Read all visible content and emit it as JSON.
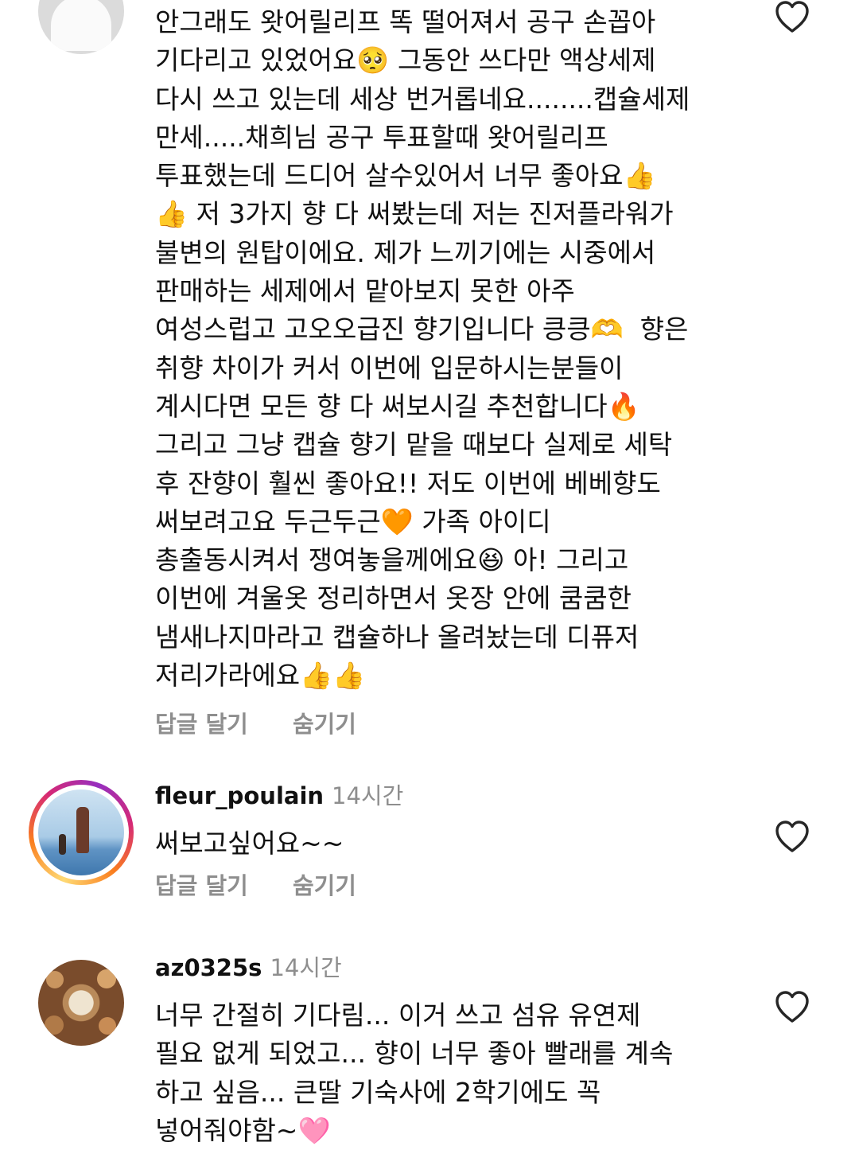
{
  "comments": [
    {
      "username": "",
      "time": "",
      "text": "안그래도 왓어릴리프 똑 떨어져서 공구 손꼽아\n기다리고 있었어요🥺 그동안 쓰다만 액상세제\n다시 쓰고 있는데 세상 번거롭네요........캡슐세제\n만세.....채희님 공구 투표할때 왓어릴리프\n투표했는데 드디어 살수있어서 너무 좋아요👍\n👍 저 3가지 향 다 써봤는데 저는 진저플라워가\n불변의 원탑이에요. 제가 느끼기에는 시중에서\n판매하는 세제에서 맡아보지 못한 아주\n여성스럽고 고오오급진 향기입니다 킁킁🫶  향은\n취향 차이가 커서 이번에 입문하시는분들이\n계시다면 모든 향 다 써보시길 추천합니다🔥\n그리고 그냥 캡슐 향기 맡을 때보다 실제로 세탁\n후 잔향이 훨씬 좋아요!! 저도 이번에 베베향도\n써보려고요 두근두근🧡 가족 아이디\n총출동시켜서 쟁여놓을께에요😆 아! 그리고\n이번에 겨울옷 정리하면서 옷장 안에 쿰쿰한\n냄새나지마라고 캡슐하나 올려놨는데 디퓨저\n저리가라에요👍👍",
      "reply": "답글 달기",
      "hide": "숨기기"
    },
    {
      "username": "fleur_poulain",
      "time": "14시간",
      "text": "써보고싶어요~~",
      "reply": "답글 달기",
      "hide": "숨기기"
    },
    {
      "username": "az0325s",
      "time": "14시간",
      "text": "너무 간절히 기다림... 이거 쓰고 섬유 유연제\n필요 없게 되었고... 향이 너무 좋아 빨래를 계속\n하고 싶음... 큰딸 기숙사에 2학기에도 꼭\n넣어줘야함~🩷",
      "reply": "",
      "hide": ""
    }
  ],
  "icons": {
    "like": "heart-outline-icon"
  }
}
